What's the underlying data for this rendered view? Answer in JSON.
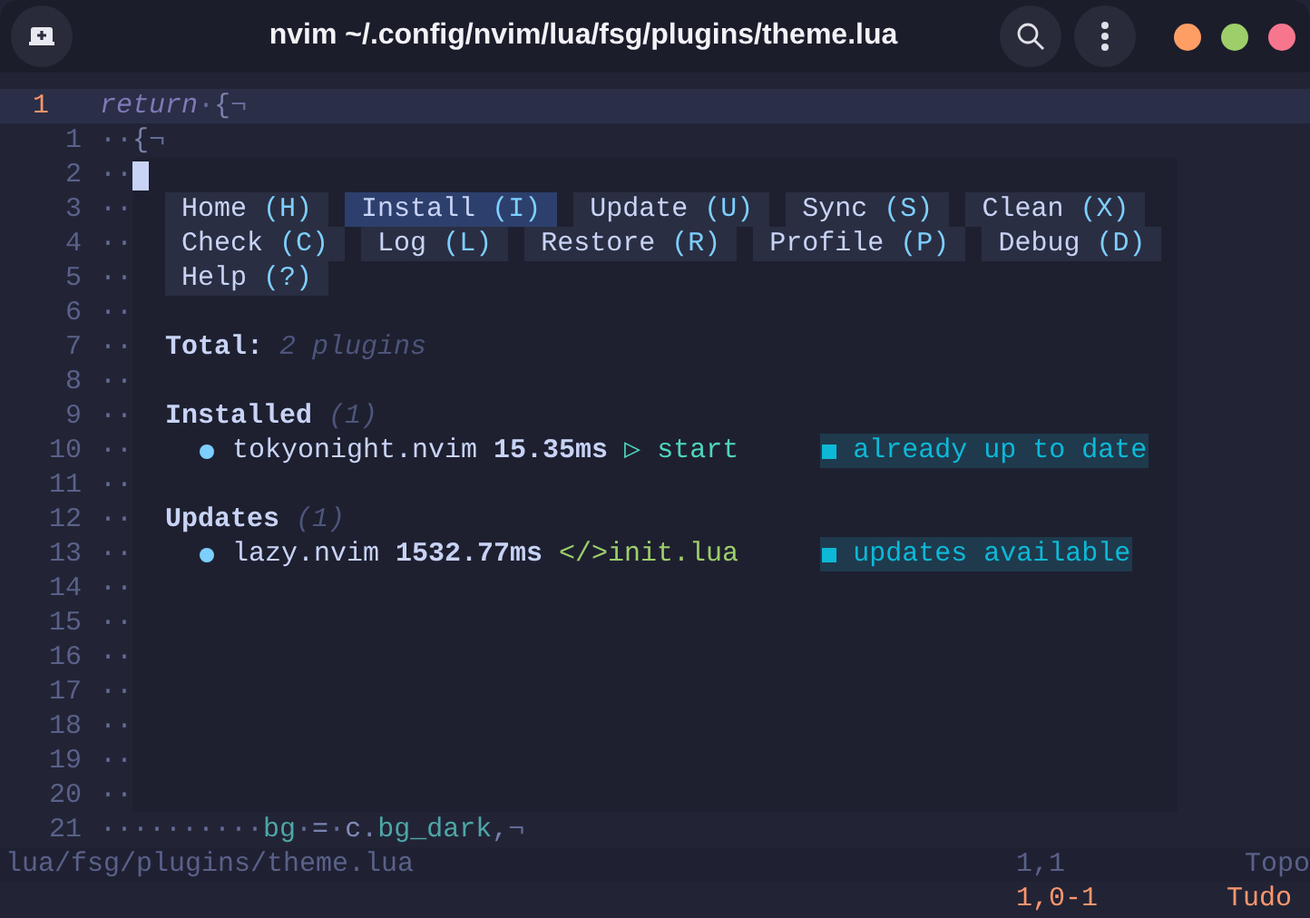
{
  "window": {
    "title": "nvim ~/.config/nvim/lua/fsg/plugins/theme.lua"
  },
  "editor": {
    "lines": [
      {
        "number": "1",
        "current": true,
        "cursor": false,
        "segments": [
          {
            "kind": "keyword",
            "text": "return"
          },
          {
            "kind": "space",
            "text": "·"
          },
          {
            "kind": "punct",
            "text": "{"
          },
          {
            "kind": "eol",
            "text": "¬"
          }
        ]
      },
      {
        "number": "1",
        "current": false,
        "cursor": false,
        "segments": [
          {
            "kind": "space",
            "text": "··"
          },
          {
            "kind": "punct",
            "text": "{"
          },
          {
            "kind": "eol",
            "text": "¬"
          }
        ]
      },
      {
        "number": "2",
        "current": false,
        "cursor": true,
        "segments": [
          {
            "kind": "space",
            "text": "··"
          }
        ]
      },
      {
        "number": "3",
        "current": false,
        "cursor": false,
        "segments": [
          {
            "kind": "space",
            "text": "··"
          }
        ]
      },
      {
        "number": "4",
        "current": false,
        "cursor": false,
        "segments": [
          {
            "kind": "space",
            "text": "··"
          }
        ]
      },
      {
        "number": "5",
        "current": false,
        "cursor": false,
        "segments": [
          {
            "kind": "space",
            "text": "··"
          }
        ]
      },
      {
        "number": "6",
        "current": false,
        "cursor": false,
        "segments": [
          {
            "kind": "space",
            "text": "··"
          }
        ]
      },
      {
        "number": "7",
        "current": false,
        "cursor": false,
        "segments": [
          {
            "kind": "space",
            "text": "··"
          }
        ]
      },
      {
        "number": "8",
        "current": false,
        "cursor": false,
        "segments": [
          {
            "kind": "space",
            "text": "··"
          }
        ]
      },
      {
        "number": "9",
        "current": false,
        "cursor": false,
        "segments": [
          {
            "kind": "space",
            "text": "··"
          }
        ]
      },
      {
        "number": "10",
        "current": false,
        "cursor": false,
        "segments": [
          {
            "kind": "space",
            "text": "··"
          }
        ]
      },
      {
        "number": "11",
        "current": false,
        "cursor": false,
        "segments": [
          {
            "kind": "space",
            "text": "··"
          }
        ]
      },
      {
        "number": "12",
        "current": false,
        "cursor": false,
        "segments": [
          {
            "kind": "space",
            "text": "··"
          }
        ]
      },
      {
        "number": "13",
        "current": false,
        "cursor": false,
        "segments": [
          {
            "kind": "space",
            "text": "··"
          }
        ]
      },
      {
        "number": "14",
        "current": false,
        "cursor": false,
        "segments": [
          {
            "kind": "space",
            "text": "··"
          }
        ]
      },
      {
        "number": "15",
        "current": false,
        "cursor": false,
        "segments": [
          {
            "kind": "space",
            "text": "··"
          }
        ]
      },
      {
        "number": "16",
        "current": false,
        "cursor": false,
        "segments": [
          {
            "kind": "space",
            "text": "··"
          }
        ]
      },
      {
        "number": "17",
        "current": false,
        "cursor": false,
        "segments": [
          {
            "kind": "space",
            "text": "··"
          }
        ]
      },
      {
        "number": "18",
        "current": false,
        "cursor": false,
        "segments": [
          {
            "kind": "space",
            "text": "··"
          }
        ]
      },
      {
        "number": "19",
        "current": false,
        "cursor": false,
        "segments": [
          {
            "kind": "space",
            "text": "··"
          }
        ]
      },
      {
        "number": "20",
        "current": false,
        "cursor": false,
        "segments": [
          {
            "kind": "space",
            "text": "··"
          }
        ]
      },
      {
        "number": "21",
        "current": false,
        "cursor": false,
        "segments": [
          {
            "kind": "space",
            "text": "··········"
          },
          {
            "kind": "field",
            "text": "bg"
          },
          {
            "kind": "space",
            "text": "·"
          },
          {
            "kind": "op",
            "text": "="
          },
          {
            "kind": "space",
            "text": "·"
          },
          {
            "kind": "var",
            "text": "c"
          },
          {
            "kind": "op",
            "text": "."
          },
          {
            "kind": "field",
            "text": "bg_dark"
          },
          {
            "kind": "op",
            "text": ","
          },
          {
            "kind": "eol",
            "text": "¬"
          }
        ]
      }
    ]
  },
  "lazy": {
    "menu": [
      {
        "label": "Home",
        "key": "(H)",
        "selected": false
      },
      {
        "label": "Install",
        "key": "(I)",
        "selected": true
      },
      {
        "label": "Update",
        "key": "(U)",
        "selected": false
      },
      {
        "label": "Sync",
        "key": "(S)",
        "selected": false
      },
      {
        "label": "Clean",
        "key": "(X)",
        "selected": false
      },
      {
        "label": "Check",
        "key": "(C)",
        "selected": false
      },
      {
        "label": "Log",
        "key": "(L)",
        "selected": false
      },
      {
        "label": "Restore",
        "key": "(R)",
        "selected": false
      },
      {
        "label": "Profile",
        "key": "(P)",
        "selected": false
      },
      {
        "label": "Debug",
        "key": "(D)",
        "selected": false
      },
      {
        "label": "Help",
        "key": "(?)",
        "selected": false
      }
    ],
    "total": {
      "label": "Total:",
      "value": "2 plugins"
    },
    "sections": [
      {
        "title": "Installed",
        "count": "(1)",
        "plugins": [
          {
            "name": "tokyonight.nvim",
            "time": "15.35ms",
            "kind": "event",
            "source_icon": "▷",
            "source": "start",
            "status": "already up to date"
          }
        ]
      },
      {
        "title": "Updates",
        "count": "(1)",
        "plugins": [
          {
            "name": "lazy.nvim",
            "time": "1532.77ms",
            "kind": "file",
            "source_icon": "</>",
            "source": "init.lua",
            "status": "updates available"
          }
        ]
      }
    ]
  },
  "statusline": {
    "path": "lua/fsg/plugins/theme.lua",
    "ruler": "1,1",
    "position": "Topo"
  },
  "cmdline": {
    "ruler": "1,0-1",
    "position": "Tudo"
  }
}
